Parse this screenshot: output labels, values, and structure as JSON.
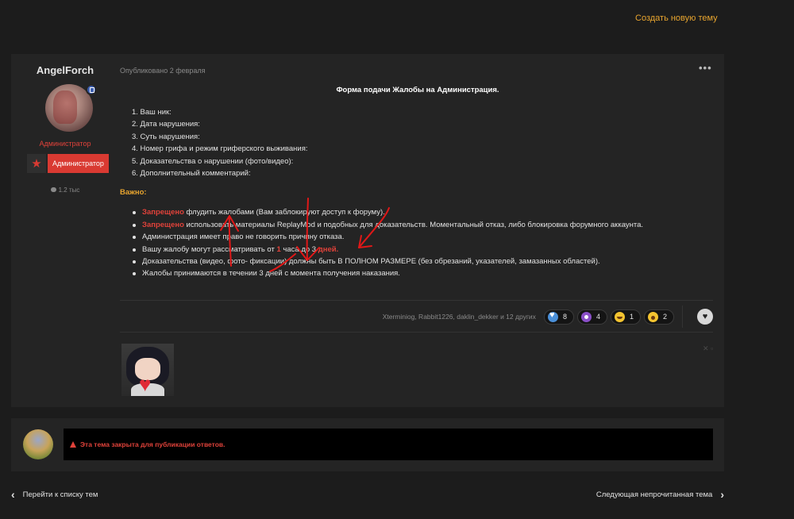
{
  "header": {
    "create_topic": "Создать новую тему"
  },
  "post": {
    "author": {
      "name": "AngelForch",
      "role_text": "Администратор",
      "role_badge": "Администратор",
      "post_count": "1.2 тыс"
    },
    "published": "Опубликовано 2 февраля",
    "more_icon": "•••",
    "form_title": "Форма подачи Жалобы на Администрация.",
    "fields": [
      "1. Ваш ник:",
      "2. Дата нарушения:",
      "3. Суть нарушения:",
      "4. Номер грифа и режим гриферского выживания:",
      "5. Доказательства о нарушении (фото/видео):",
      "6. Дополнительный комментарий:"
    ],
    "important_label": "Важно:",
    "rules": {
      "r1_highlight": "Запрещено",
      "r1_text": " флудить жалобами (Вам заблокируют доступ к форуму).",
      "r2_highlight": "Запрещено",
      "r2_text": " использовать материалы ReplayMod и подобных для доказательств. Моментальный отказ, либо блокировка форумного аккаунта.",
      "r3_text": "Администрация имеет право не говорить причину отказа.",
      "r4_text_a": "Вашу жалобу могут рассматривать от ",
      "r4_num": "1",
      "r4_text_b": " часа до 3 ",
      "r4_days": "дней.",
      "r5_text": "Доказательства (видео, фото- фиксации) должны быть В ПОЛНОМ РАЗМЕРЕ (без обрезаний, указателей, замазанных областей).",
      "r6_text": "Жалобы принимаются в течении 3 дней с момента получения наказания."
    },
    "reactions": {
      "reactors": "Xterminiog, Rabbit1226, daklin_dekker и 12 других",
      "items": [
        {
          "icon": "heart-reaction-icon",
          "count": "8"
        },
        {
          "icon": "purple-reaction-icon",
          "count": "4"
        },
        {
          "icon": "laugh-reaction-icon",
          "count": "1"
        },
        {
          "icon": "wow-reaction-icon",
          "count": "2"
        }
      ]
    },
    "signature_controls": "✕ ▫"
  },
  "closed": {
    "message": "Эта тема закрыта для публикации ответов."
  },
  "nav": {
    "back": "Перейти к списку тем",
    "next": "Следующая непрочитанная тема"
  },
  "colors": {
    "accent": "#e8a52f",
    "danger": "#e0423a",
    "background": "#1c1c1c",
    "panel": "#242424"
  }
}
